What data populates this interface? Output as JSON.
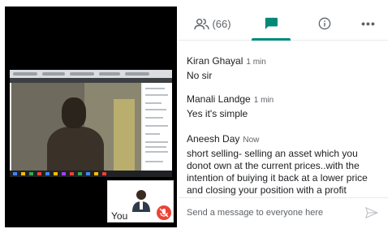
{
  "header": {
    "participants_count": "(66)",
    "more_label": "•••"
  },
  "icons": {
    "people": "people-icon",
    "chat": "chat-icon",
    "info": "info-icon",
    "more": "more-icon",
    "send": "send-icon",
    "mic_off": "mic-off-icon"
  },
  "colors": {
    "accent": "#00897b",
    "mic_off": "#ea4335",
    "stage": "#000000"
  },
  "self_tile": {
    "label": "You"
  },
  "chat": {
    "messages": [
      {
        "sender": "Kiran Ghayal",
        "time": "1 min",
        "text": "No sir"
      },
      {
        "sender": "Manali Landge",
        "time": "1 min",
        "text": "Yes it's simple"
      },
      {
        "sender": "Aneesh Day",
        "time": "Now",
        "text": "short selling- selling an asset which  you donot own at the current prices..with the intention of buiying it back at a lower price and closing your position with a profit"
      }
    ],
    "composer_placeholder": "Send a message to everyone here"
  }
}
